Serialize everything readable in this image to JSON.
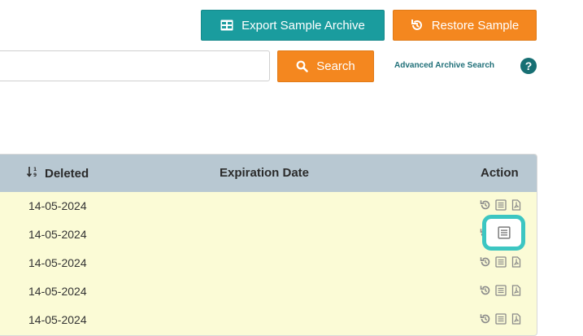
{
  "toolbar": {
    "export_label": "Export Sample Archive",
    "restore_label": "Restore Sample",
    "search_label": "Search",
    "search_placeholder": "",
    "advanced_search_label": "Advanced Archive Search",
    "help_label": "?"
  },
  "table": {
    "columns": {
      "deleted": "Deleted",
      "expiration": "Expiration Date",
      "action": "Action"
    },
    "rows": [
      {
        "deleted": "14-05-2024",
        "expiration": ""
      },
      {
        "deleted": "14-05-2024",
        "expiration": ""
      },
      {
        "deleted": "14-05-2024",
        "expiration": ""
      },
      {
        "deleted": "14-05-2024",
        "expiration": ""
      },
      {
        "deleted": "14-05-2024",
        "expiration": ""
      }
    ]
  },
  "colors": {
    "teal_button": "#1a9c9e",
    "orange_button": "#f4871f",
    "header_bg": "#b8c8d2",
    "row_bg": "#fbfbd6",
    "highlight": "#3cc6c2"
  },
  "icons": {
    "export": "table-icon",
    "restore": "history-icon",
    "search": "search-icon",
    "help": "question-icon",
    "sort": "sort-numeric-icon",
    "row_actions": [
      "history-icon",
      "list-icon",
      "pdf-icon"
    ]
  }
}
